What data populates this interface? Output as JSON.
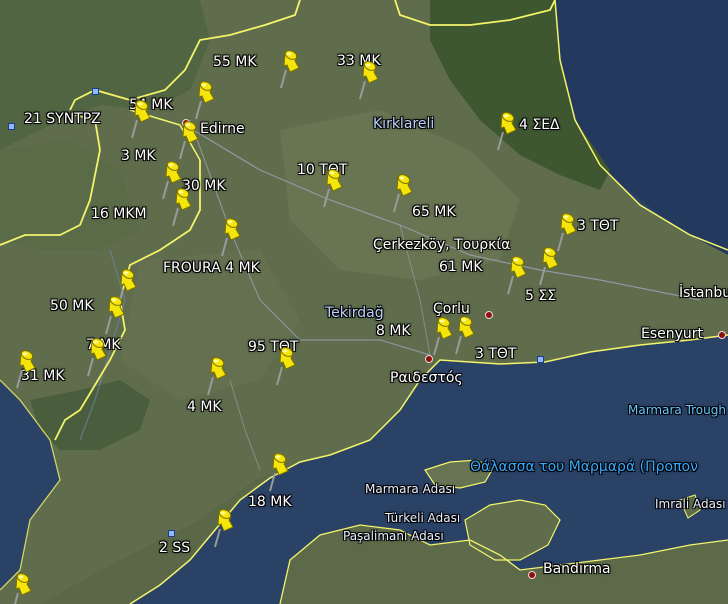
{
  "map": {
    "colors": {
      "land": "#5d6b4c",
      "forest": "#3f5a33",
      "sea": "#2c4266",
      "border": "#f4f46a",
      "pin": "#f5e50a",
      "road": "#9aa0b0"
    },
    "pin_icon": "yellow-pushpin",
    "pin_labels": [
      "55 MK",
      "33 MK",
      "21 SYNTPZ",
      "54 MK",
      "3 MK",
      "4 ΣΕΔ",
      "10 ΤΘΤ",
      "30 MK",
      "16 MKM",
      "65 MK",
      "3 ΤΘΤ",
      "FROURA 4 MK",
      "61 MK",
      "5 ΣΣ",
      "50 MK",
      "8 MK",
      "7 MK",
      "95 ΤΘΤ",
      "3 ΤΘΤ",
      "31 MK",
      "4 MK",
      "18 MK",
      "2 SS"
    ],
    "cities": {
      "edirne": "Edirne",
      "kirklareli": "Kırklareli",
      "cerkezkoy": "Çerkezköy, Τουρκία",
      "tekirdag": "Tekirdağ",
      "corlu": "Çorlu",
      "raidestos": "Ραιδεστός",
      "istanbul": "İstanbu",
      "esenyurt": "Esenyurt",
      "bandirma": "Bandırma"
    },
    "water": {
      "marmara_sea": "Θάλασσα του Μαρμαρά (Προπον",
      "marmara_trough": "Marmara Trough"
    },
    "islands": {
      "marmara": "Marmara Adası",
      "turkeli": "Türkeli Adası",
      "pasalimani": "Paşalimanı Adası",
      "imrali": "Imrali Adası"
    }
  }
}
